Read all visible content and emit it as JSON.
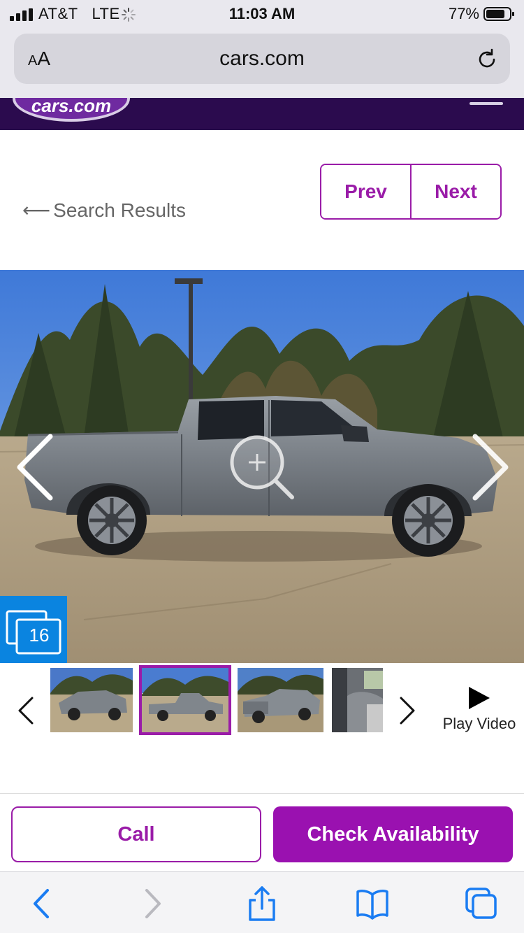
{
  "status_bar": {
    "carrier": "AT&T",
    "network": "LTE",
    "time": "11:03 AM",
    "battery": "77%"
  },
  "browser": {
    "text_size_button": {
      "small": "A",
      "large": "A"
    },
    "url": "cars.com"
  },
  "site_header": {
    "logo_text": "cars.com"
  },
  "nav": {
    "back_arrow": "⟵",
    "back_label": "Search Results",
    "prev_label": "Prev",
    "next_label": "Next"
  },
  "gallery": {
    "photo_count": "16",
    "selected_thumbnail": 2,
    "thumbnail_count_visible": 4,
    "play_video_label": "Play Video"
  },
  "actions": {
    "call_label": "Call",
    "check_availability_label": "Check Availability"
  },
  "colors": {
    "brand_purple": "#9a11b0",
    "header_purple": "#2b0b4e",
    "photo_badge_blue": "#0a84e0",
    "ios_blue": "#1a7cf2"
  },
  "toolbar": {
    "icons": [
      "back-icon",
      "forward-icon",
      "share-icon",
      "bookmarks-icon",
      "tabs-icon"
    ]
  }
}
